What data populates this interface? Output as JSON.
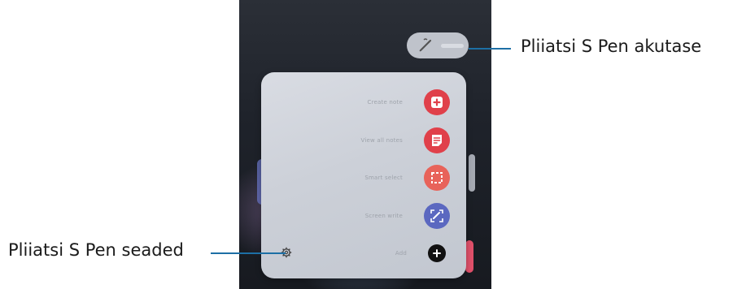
{
  "menu": {
    "items": [
      {
        "label": "Create note",
        "icon": "create-note-icon",
        "color": "#e0404a"
      },
      {
        "label": "View all notes",
        "icon": "view-all-notes-icon",
        "color": "#e0404a"
      },
      {
        "label": "Smart select",
        "icon": "smart-select-icon",
        "color": "#e8635a"
      },
      {
        "label": "Screen write",
        "icon": "screen-write-icon",
        "color": "#5b68c0"
      },
      {
        "label": "Add",
        "icon": "add-icon",
        "color": "#111111"
      }
    ]
  },
  "callouts": {
    "battery": "Pliiatsi S Pen akutase",
    "settings": "Pliiatsi S Pen seaded"
  },
  "colors": {
    "callout_line": "#1d6fa5",
    "panel": "#d3d6dd"
  }
}
